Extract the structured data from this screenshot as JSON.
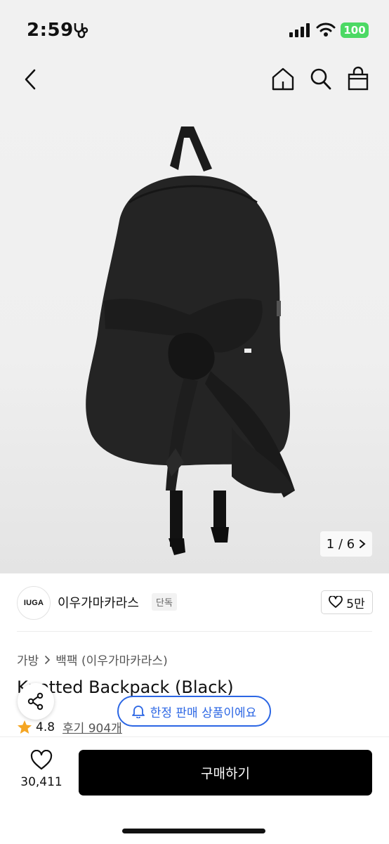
{
  "status": {
    "time": "2:59",
    "battery": "100"
  },
  "nav": {
    "icons": [
      "back-icon",
      "home-icon",
      "search-icon",
      "shopping-bag-icon"
    ]
  },
  "gallery": {
    "counter": "1 / 6"
  },
  "brand": {
    "logo_text": "IUGA",
    "name": "이우가마카라스",
    "tag": "단독",
    "likes": "5만"
  },
  "breadcrumb": {
    "items": [
      "가방",
      "백팩 (이우가마카라스)"
    ]
  },
  "product": {
    "title": "Knotted Backpack (Black)",
    "rating": "4.8",
    "reviews": "후기 904개"
  },
  "notice": {
    "text": "한정 판매 상품이에요"
  },
  "bottom_bar": {
    "wish_count": "30,411",
    "buy_label": "구매하기"
  },
  "colors": {
    "accent": "#2b66e4",
    "star": "#f5a623",
    "battery": "#4cd964",
    "buy_button": "#000000"
  }
}
